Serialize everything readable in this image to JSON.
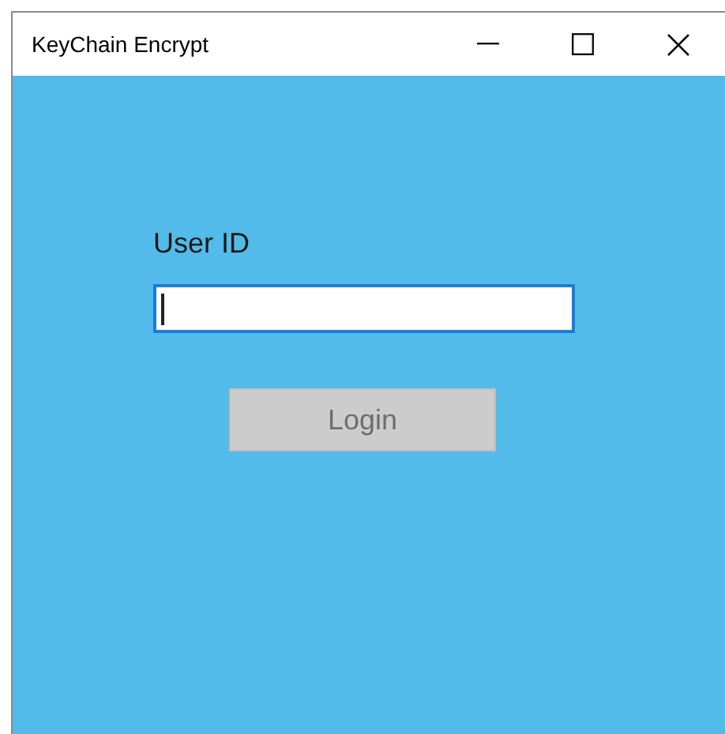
{
  "window": {
    "title": "KeyChain Encrypt"
  },
  "user_id": {
    "label": "User ID",
    "focused": true
  },
  "login_button": {
    "label": "Login",
    "disabled": true
  }
}
